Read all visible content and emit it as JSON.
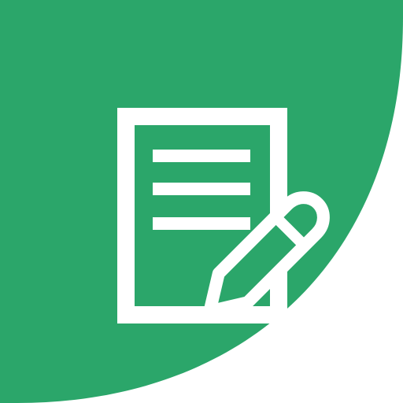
{
  "app_icon": {
    "name": "notes-app-icon",
    "colors": {
      "background": "#2ba66a",
      "glyph": "#ffffff",
      "canvas": "#ffffff"
    },
    "glyph_icon": "document-with-pencil-icon"
  }
}
